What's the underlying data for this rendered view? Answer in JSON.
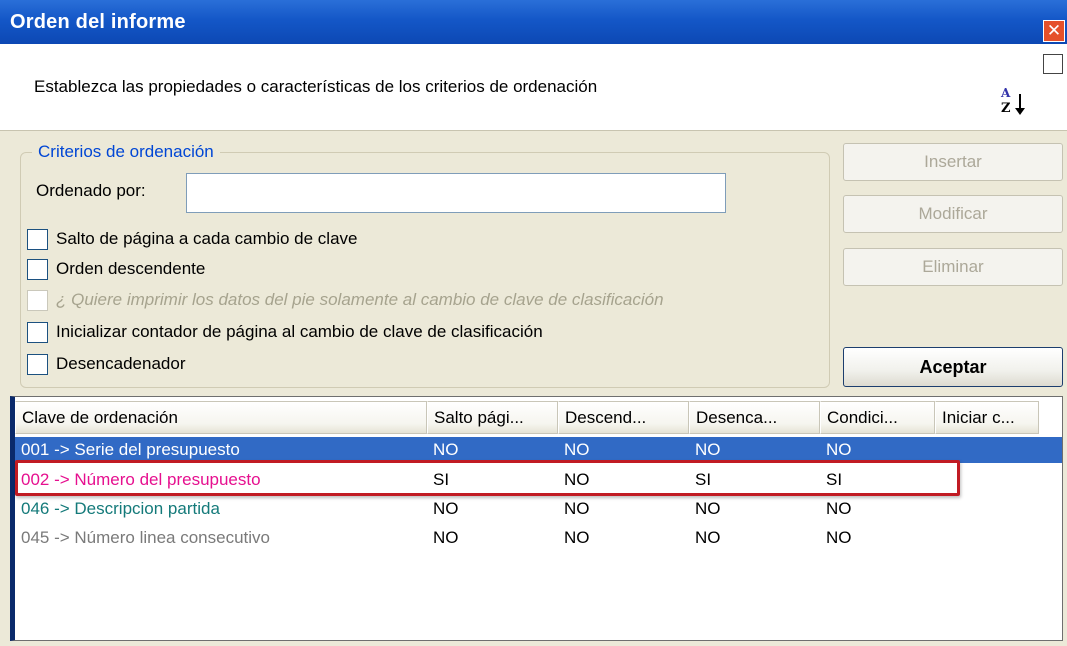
{
  "window": {
    "title": "Orden del informe",
    "close_glyph": "✕"
  },
  "header": {
    "description": "Establezca las propiedades o características de los criterios de ordenación",
    "icon": "sort-az-icon"
  },
  "criteria": {
    "legend": "Criterios de ordenación",
    "ordered_by_label": "Ordenado por:",
    "ordered_by_value": "",
    "checkboxes": [
      {
        "label": "Salto de página a cada cambio de clave",
        "checked": false,
        "enabled": true
      },
      {
        "label": "Orden descendente",
        "checked": false,
        "enabled": true
      },
      {
        "label": "¿ Quiere imprimir los datos del pie solamente al cambio de clave de clasificación",
        "checked": false,
        "enabled": false
      },
      {
        "label": "Inicializar contador de página al cambio de clave de clasificación",
        "checked": false,
        "enabled": true
      },
      {
        "label": "Desencadenador",
        "checked": false,
        "enabled": true
      }
    ]
  },
  "buttons": {
    "insert": "Insertar",
    "modify": "Modificar",
    "delete": "Eliminar",
    "accept": "Aceptar"
  },
  "list": {
    "columns": [
      "Clave de ordenación",
      "Salto pági...",
      "Descend...",
      "Desenca...",
      "Condici...",
      "Iniciar c..."
    ],
    "rows": [
      {
        "key": "001 -> Serie del presupuesto",
        "salto": "NO",
        "desc": "NO",
        "desenc": "NO",
        "cond": "NO",
        "init": "",
        "color": "#ffffff",
        "selected": true
      },
      {
        "key": "002 -> Número del presupuesto",
        "salto": "SI",
        "desc": "NO",
        "desenc": "SI",
        "cond": "SI",
        "init": "",
        "color": "#e6108f",
        "selected": false
      },
      {
        "key": "046 -> Descripcion partida",
        "salto": "NO",
        "desc": "NO",
        "desenc": "NO",
        "cond": "NO",
        "init": "",
        "color": "#147a7a",
        "selected": false
      },
      {
        "key": "045 -> Número linea consecutivo",
        "salto": "NO",
        "desc": "NO",
        "desenc": "NO",
        "cond": "NO",
        "init": "",
        "color": "#7a7a7a",
        "selected": false
      }
    ]
  },
  "colors": {
    "titlebar": "#1457c7",
    "selection": "#316ac5",
    "highlight_border": "#c11b23",
    "legend_text": "#0046d5"
  }
}
